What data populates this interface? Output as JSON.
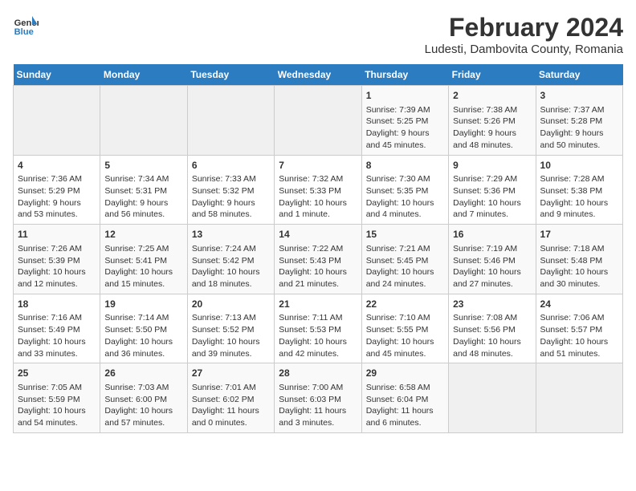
{
  "logo": {
    "line1": "General",
    "line2": "Blue"
  },
  "title": "February 2024",
  "subtitle": "Ludesti, Dambovita County, Romania",
  "days_of_week": [
    "Sunday",
    "Monday",
    "Tuesday",
    "Wednesday",
    "Thursday",
    "Friday",
    "Saturday"
  ],
  "weeks": [
    [
      {
        "day": "",
        "empty": true
      },
      {
        "day": "",
        "empty": true
      },
      {
        "day": "",
        "empty": true
      },
      {
        "day": "",
        "empty": true
      },
      {
        "day": "1",
        "sunrise": "7:39 AM",
        "sunset": "5:25 PM",
        "daylight": "9 hours and 45 minutes."
      },
      {
        "day": "2",
        "sunrise": "7:38 AM",
        "sunset": "5:26 PM",
        "daylight": "9 hours and 48 minutes."
      },
      {
        "day": "3",
        "sunrise": "7:37 AM",
        "sunset": "5:28 PM",
        "daylight": "9 hours and 50 minutes."
      }
    ],
    [
      {
        "day": "4",
        "sunrise": "7:36 AM",
        "sunset": "5:29 PM",
        "daylight": "9 hours and 53 minutes."
      },
      {
        "day": "5",
        "sunrise": "7:34 AM",
        "sunset": "5:31 PM",
        "daylight": "9 hours and 56 minutes."
      },
      {
        "day": "6",
        "sunrise": "7:33 AM",
        "sunset": "5:32 PM",
        "daylight": "9 hours and 58 minutes."
      },
      {
        "day": "7",
        "sunrise": "7:32 AM",
        "sunset": "5:33 PM",
        "daylight": "10 hours and 1 minute."
      },
      {
        "day": "8",
        "sunrise": "7:30 AM",
        "sunset": "5:35 PM",
        "daylight": "10 hours and 4 minutes."
      },
      {
        "day": "9",
        "sunrise": "7:29 AM",
        "sunset": "5:36 PM",
        "daylight": "10 hours and 7 minutes."
      },
      {
        "day": "10",
        "sunrise": "7:28 AM",
        "sunset": "5:38 PM",
        "daylight": "10 hours and 9 minutes."
      }
    ],
    [
      {
        "day": "11",
        "sunrise": "7:26 AM",
        "sunset": "5:39 PM",
        "daylight": "10 hours and 12 minutes."
      },
      {
        "day": "12",
        "sunrise": "7:25 AM",
        "sunset": "5:41 PM",
        "daylight": "10 hours and 15 minutes."
      },
      {
        "day": "13",
        "sunrise": "7:24 AM",
        "sunset": "5:42 PM",
        "daylight": "10 hours and 18 minutes."
      },
      {
        "day": "14",
        "sunrise": "7:22 AM",
        "sunset": "5:43 PM",
        "daylight": "10 hours and 21 minutes."
      },
      {
        "day": "15",
        "sunrise": "7:21 AM",
        "sunset": "5:45 PM",
        "daylight": "10 hours and 24 minutes."
      },
      {
        "day": "16",
        "sunrise": "7:19 AM",
        "sunset": "5:46 PM",
        "daylight": "10 hours and 27 minutes."
      },
      {
        "day": "17",
        "sunrise": "7:18 AM",
        "sunset": "5:48 PM",
        "daylight": "10 hours and 30 minutes."
      }
    ],
    [
      {
        "day": "18",
        "sunrise": "7:16 AM",
        "sunset": "5:49 PM",
        "daylight": "10 hours and 33 minutes."
      },
      {
        "day": "19",
        "sunrise": "7:14 AM",
        "sunset": "5:50 PM",
        "daylight": "10 hours and 36 minutes."
      },
      {
        "day": "20",
        "sunrise": "7:13 AM",
        "sunset": "5:52 PM",
        "daylight": "10 hours and 39 minutes."
      },
      {
        "day": "21",
        "sunrise": "7:11 AM",
        "sunset": "5:53 PM",
        "daylight": "10 hours and 42 minutes."
      },
      {
        "day": "22",
        "sunrise": "7:10 AM",
        "sunset": "5:55 PM",
        "daylight": "10 hours and 45 minutes."
      },
      {
        "day": "23",
        "sunrise": "7:08 AM",
        "sunset": "5:56 PM",
        "daylight": "10 hours and 48 minutes."
      },
      {
        "day": "24",
        "sunrise": "7:06 AM",
        "sunset": "5:57 PM",
        "daylight": "10 hours and 51 minutes."
      }
    ],
    [
      {
        "day": "25",
        "sunrise": "7:05 AM",
        "sunset": "5:59 PM",
        "daylight": "10 hours and 54 minutes."
      },
      {
        "day": "26",
        "sunrise": "7:03 AM",
        "sunset": "6:00 PM",
        "daylight": "10 hours and 57 minutes."
      },
      {
        "day": "27",
        "sunrise": "7:01 AM",
        "sunset": "6:02 PM",
        "daylight": "11 hours and 0 minutes."
      },
      {
        "day": "28",
        "sunrise": "7:00 AM",
        "sunset": "6:03 PM",
        "daylight": "11 hours and 3 minutes."
      },
      {
        "day": "29",
        "sunrise": "6:58 AM",
        "sunset": "6:04 PM",
        "daylight": "11 hours and 6 minutes."
      },
      {
        "day": "",
        "empty": true
      },
      {
        "day": "",
        "empty": true
      }
    ]
  ]
}
